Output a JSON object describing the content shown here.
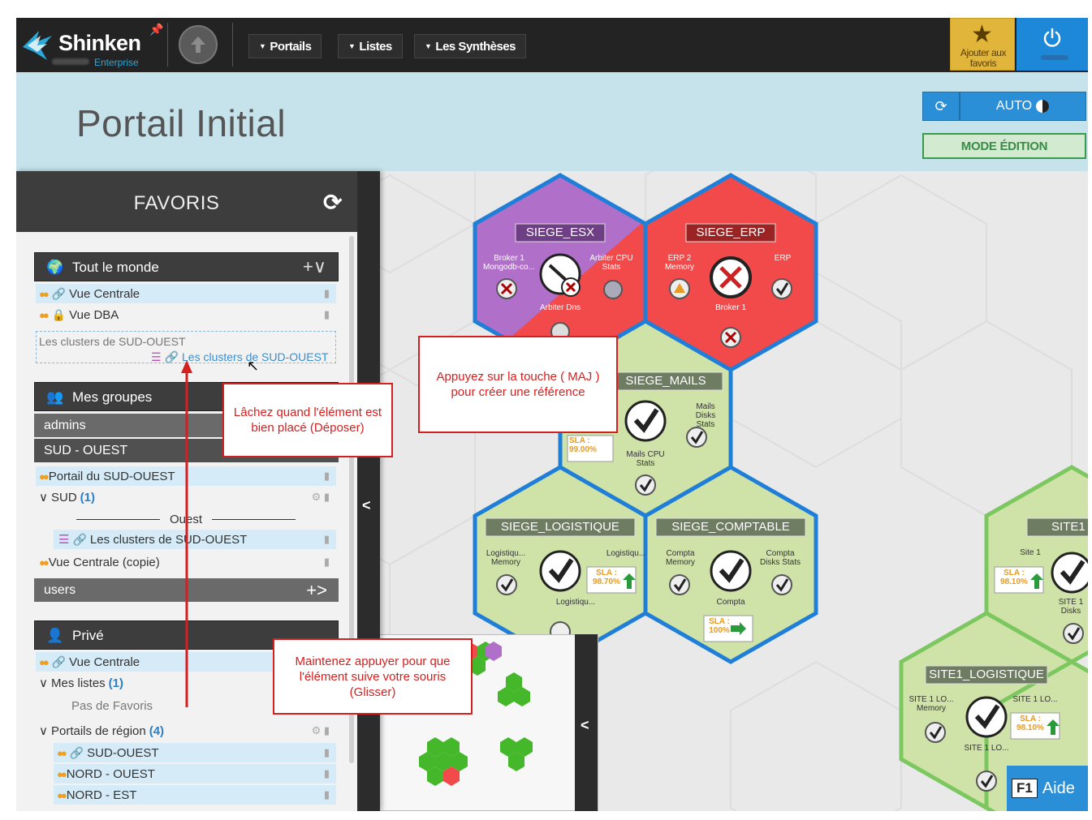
{
  "topbar": {
    "brand": "Shinken",
    "brand_sub": "Enterprise",
    "nav": [
      "Portails",
      "Listes",
      "Les Synthèses"
    ],
    "favorites_button": "Ajouter aux favoris"
  },
  "header": {
    "title": "Portail Initial",
    "auto_label": "AUTO",
    "edit_mode_label": "MODE ÉDITION"
  },
  "favorites": {
    "title": "FAVORIS",
    "everyone": {
      "label": "Tout le monde",
      "items": [
        "Vue Centrale",
        "Vue DBA"
      ],
      "drop_placeholder": "Les clusters de SUD-OUEST",
      "dragged_item": "Les clusters de SUD-OUEST"
    },
    "groups": {
      "label": "Mes groupes",
      "admins": "admins",
      "sud_ouest": "SUD - OUEST",
      "items": [
        "Portail du SUD-OUEST",
        "SUD",
        "Ouest",
        "Les clusters de SUD-OUEST",
        "Vue Centrale (copie)"
      ],
      "sud_count": "(1)",
      "users": "users"
    },
    "private": {
      "label": "Privé",
      "items": [
        "Vue Centrale",
        "Mes listes",
        "Pas de Favoris",
        "Portails de région",
        "SUD-OUEST",
        "NORD - OUEST",
        "NORD - EST"
      ],
      "mes_listes_count": "(1)",
      "regions_count": "(4)"
    }
  },
  "hexes": {
    "siege_esx": {
      "title": "SIEGE_ESX",
      "labels": [
        "Broker 1 Mongodb-co...",
        "Arbiter CPU Stats",
        "Arbiter Dns"
      ]
    },
    "siege_erp": {
      "title": "SIEGE_ERP",
      "labels": [
        "ERP 2 Memory",
        "ERP",
        "Broker 1"
      ]
    },
    "siege_mails": {
      "title": "SIEGE_MAILS",
      "labels": [
        "Mails Disks Stats",
        "Mails CPU Stats"
      ],
      "sla": "99.00%"
    },
    "siege_logistique": {
      "title": "SIEGE_LOGISTIQUE",
      "labels": [
        "Logistiqu... Memory",
        "Logistiqu...",
        "Logistiqu..."
      ],
      "sla": "98.70%"
    },
    "siege_comptable": {
      "title": "SIEGE_COMPTABLE",
      "labels": [
        "Compta Memory",
        "Compta Disks Stats",
        "Compta"
      ],
      "sla": "100%"
    },
    "site1": {
      "title": "SITE1",
      "labels": [
        "Site 1",
        "SITE 1 Disks"
      ],
      "sla": "98.10%"
    },
    "site1_logistique": {
      "title": "SITE1_LOGISTIQUE",
      "labels": [
        "SITE 1 LO... Memory",
        "SITE 1 LO...",
        "SITE 1 LO..."
      ],
      "sla": "98.10%"
    },
    "sla_label": "SLA :"
  },
  "callouts": {
    "shift": "Appuyez sur la touche ( MAJ ) pour créer une référence",
    "drop": "Lâchez quand l'élément est bien placé (Déposer)",
    "drag": "Maintenez appuyer pour que l'élément suive votre souris (Glisser)"
  },
  "help": {
    "key": "F1",
    "label": "Aide"
  },
  "colors": {
    "critical": "#f24a4a",
    "ok": "#cfe3a8",
    "purple": "#b06fc8",
    "blue_border": "#1f7fd8",
    "green_border": "#7cc760"
  }
}
